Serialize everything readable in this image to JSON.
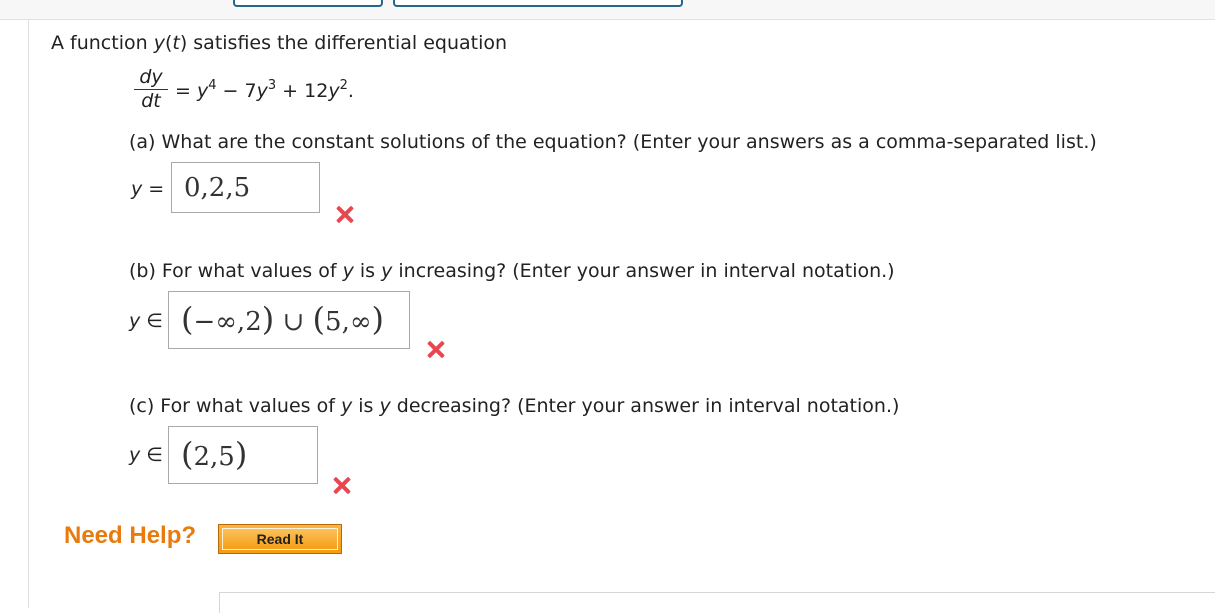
{
  "problem": {
    "intro": "A function y(t) satisfies the differential equation",
    "intro_before": "A function ",
    "intro_y": "y",
    "intro_paren_open": "(",
    "intro_t": "t",
    "intro_after": ") satisfies the differential equation",
    "equation": {
      "numerator": "dy",
      "denominator": "dt",
      "rhs_eq": "= ",
      "y1": "y",
      "p1": "4",
      "minus": " − 7",
      "y2": "y",
      "p2": "3",
      "plus": " + 12",
      "y3": "y",
      "p3": "2",
      "period": "."
    }
  },
  "parts": [
    {
      "question": "(a) What are the constant solutions of the equation? (Enter your answers as a comma-separated list.)",
      "prefix_var": "y",
      "prefix_sym": " =",
      "answer": "0,2,5",
      "status": "incorrect"
    },
    {
      "question_a": "(b) For what values of ",
      "question_y1": "y",
      "question_b": " is ",
      "question_y2": "y",
      "question_c": " increasing? (Enter your answer in interval notation.)",
      "prefix_var": "y",
      "prefix_sym": " ∈",
      "answer": "(−∞,2) ∪ (5,∞)",
      "answer_seg1": "−∞,2",
      "answer_union": " ∪ ",
      "answer_seg2": "5,∞",
      "status": "incorrect"
    },
    {
      "question_a": "(c) For what values of ",
      "question_y1": "y",
      "question_b": " is ",
      "question_y2": "y",
      "question_c": " decreasing? (Enter your answer in interval notation.)",
      "prefix_var": "y",
      "prefix_sym": " ∈",
      "answer": "(2,5)",
      "answer_seg1": "2,5",
      "status": "incorrect"
    }
  ],
  "help": {
    "label": "Need Help?",
    "read_it_button": "Read It"
  },
  "icons": {
    "incorrect": "red-x-icon"
  },
  "colors": {
    "incorrect": "#e8474f",
    "need_help": "#e87b0c",
    "read_it_button": "#f59e17",
    "top_button_border": "#27648a"
  }
}
